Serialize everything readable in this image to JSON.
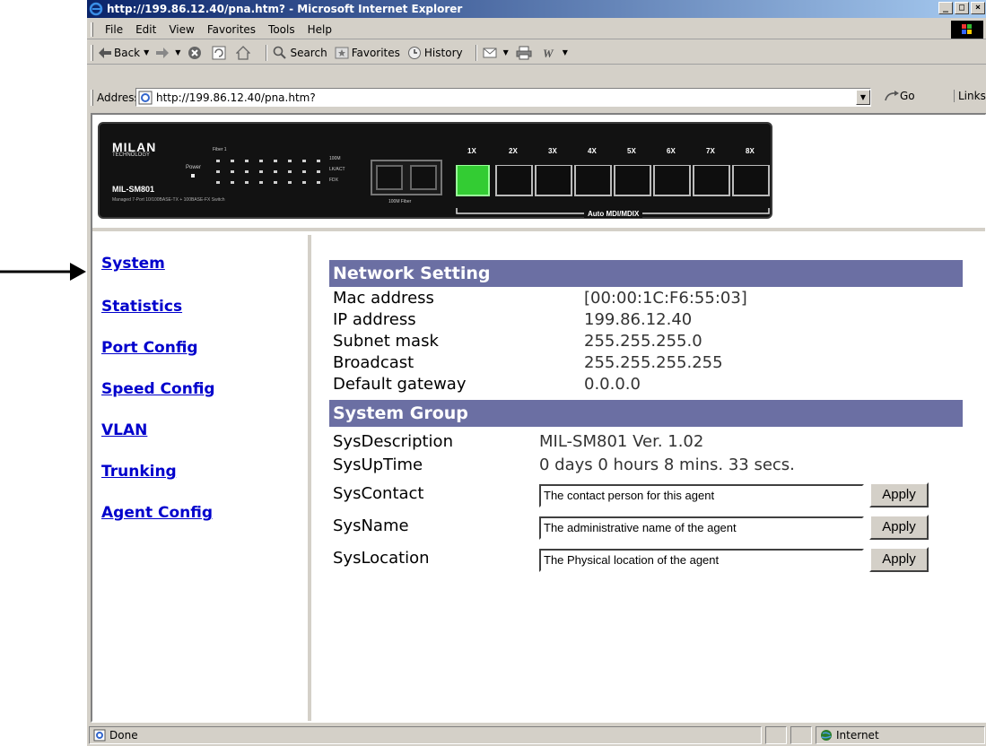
{
  "window": {
    "title": "http://199.86.12.40/pna.htm? - Microsoft Internet Explorer",
    "minimize": "_",
    "maximize": "□",
    "close": "×"
  },
  "menu": [
    "File",
    "Edit",
    "View",
    "Favorites",
    "Tools",
    "Help"
  ],
  "toolbar": {
    "back": "Back",
    "search": "Search",
    "favorites": "Favorites",
    "history": "History"
  },
  "address": {
    "label": "Address",
    "url": "http://199.86.12.40/pna.htm?",
    "go": "Go",
    "links": "Links"
  },
  "device": {
    "brand": "MILAN",
    "brand_sub": "TECHNOLOGY",
    "model": "MIL-SM801",
    "subtitle": "Managed 7-Port 10/100BASE-TX + 100BASE-FX Switch",
    "fiber_label": "100M Fiber",
    "port_labels": [
      "1X",
      "2X",
      "3X",
      "4X",
      "5X",
      "6X",
      "7X",
      "8X"
    ],
    "active_port": "1X",
    "auto_label": "Auto MDI/MDIX",
    "led_rows": [
      "100M",
      "LK/ACT",
      "FDX"
    ],
    "power_label": "Power",
    "fiber_col_label": "Fiber 1"
  },
  "nav": {
    "items": [
      "System",
      "Statistics",
      "Port Config",
      "Speed Config",
      "VLAN",
      "Trunking",
      "Agent Config"
    ],
    "selected": "System"
  },
  "network": {
    "header": "Network Setting",
    "rows": [
      {
        "label": "Mac address",
        "value": "[00:00:1C:F6:55:03]"
      },
      {
        "label": "IP address",
        "value": "199.86.12.40"
      },
      {
        "label": "Subnet mask",
        "value": "255.255.255.0"
      },
      {
        "label": "Broadcast",
        "value": "255.255.255.255"
      },
      {
        "label": "Default gateway",
        "value": "0.0.0.0"
      }
    ]
  },
  "system": {
    "header": "System Group",
    "description_label": "SysDescription",
    "description": "MIL-SM801 Ver. 1.02",
    "uptime_label": "SysUpTime",
    "uptime": "0 days 0 hours 8 mins. 33 secs.",
    "fields": [
      {
        "label": "SysContact",
        "value": "The contact person for this agent",
        "button": "Apply"
      },
      {
        "label": "SysName",
        "value": "The administrative name of the agent",
        "button": "Apply"
      },
      {
        "label": "SysLocation",
        "value": "The Physical location of the agent",
        "button": "Apply"
      }
    ]
  },
  "status": {
    "left": "Done",
    "zone": "Internet"
  },
  "colors": {
    "section_header": "#6b6fa3",
    "link": "#0000cc",
    "titlebar_start": "#0a246a"
  }
}
